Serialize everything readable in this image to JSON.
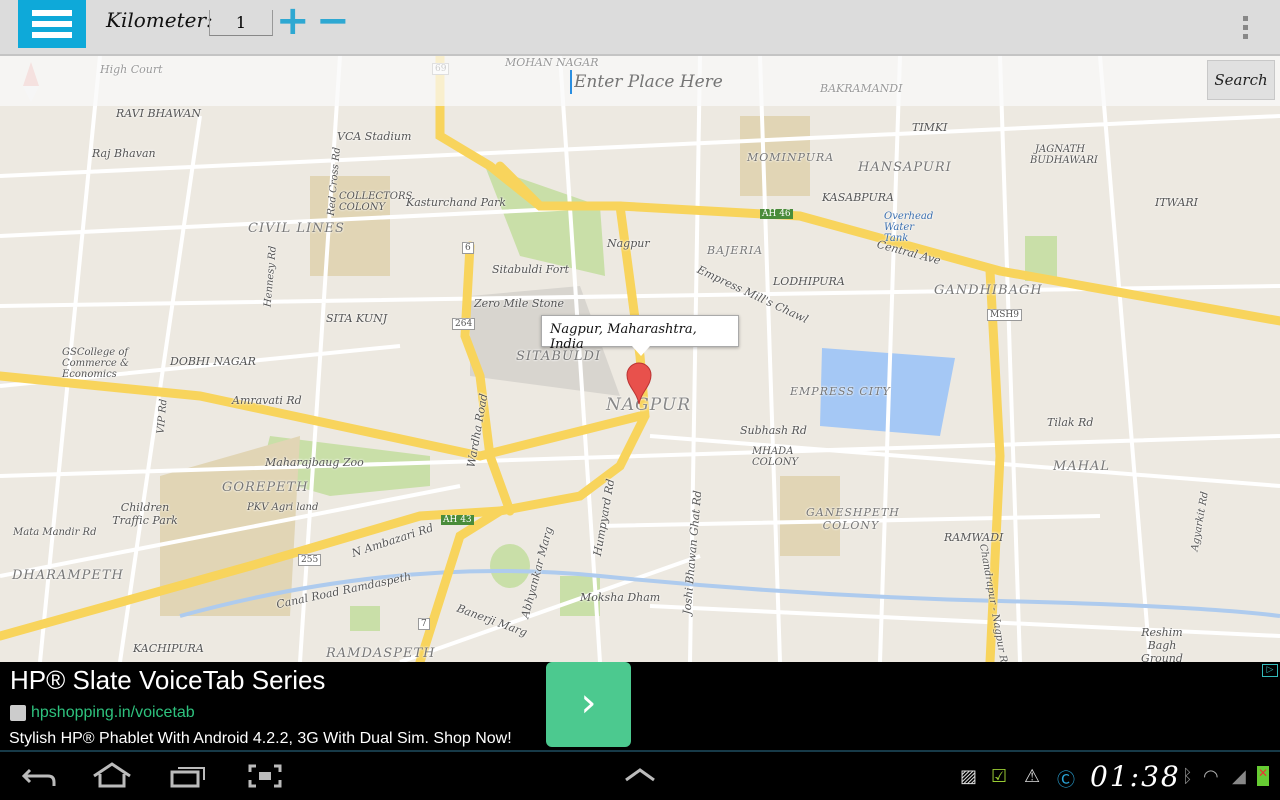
{
  "topbar": {
    "km_label": "Kilometer:",
    "km_value": "1",
    "plus": "+",
    "minus": "−",
    "menu_icon": "hamburger-icon",
    "overflow_icon": "vertical-dots-icon",
    "accent": "#0ea9d9"
  },
  "search": {
    "placeholder": "Enter Place Here",
    "button": "Search"
  },
  "map": {
    "info_window": "Nagpur, Maharashtra, India",
    "labels": [
      "High Court",
      "RAVI BHAWAN",
      "Raj Bhavan",
      "VCA Stadium",
      "COLLECTORS COLONY",
      "Kasturchand Park",
      "CIVIL LINES",
      "Sitabuldi Fort",
      "Zero Mile Stone",
      "SITA KUNJ",
      "SITABULDI",
      "NAGPUR",
      "DOBHI NAGAR",
      "GSCollege of Commerce & Economics",
      "Amravati Rd",
      "Maharajbaug Zoo",
      "GOREPETH",
      "PKV Agri land",
      "Children Traffic Park",
      "Mata Mandir Rd",
      "DHARAMPETH",
      "KACHIPURA",
      "RAMDASPETH",
      "Canal Road Ramdaspeth",
      "N Ambazari Rd",
      "Wardha Road",
      "Humpyard Rd",
      "Moksha Dham",
      "Joshi Bhawan Ghat Rd",
      "Banerji Marg",
      "Abhyankar Marg",
      "Subhash Rd",
      "MHADA COLONY",
      "EMPRESS CITY",
      "GANESHPETH COLONY",
      "MOMINPURA",
      "HANSAPURI",
      "KASABPURA",
      "Overhead Water Tank",
      "Central Ave",
      "BAJERIA",
      "LODHIPURA",
      "Empress Mill's Chawl",
      "GANDHIBAGH",
      "TIMKI",
      "JAGNATH BUDHAWARI",
      "ITWARI",
      "Tilak Rd",
      "MAHAL",
      "RAMWADI",
      "Reshim Bagh Ground",
      "Nagpur",
      "MOHAN NAGAR",
      "BAKRAMANDI",
      "Hennesy Rd",
      "Red Cross Rd",
      "VIP Rd",
      "Chandrapur - Nagpur Rd",
      "Agyarkit Rd"
    ],
    "shields": [
      "69",
      "6",
      "264",
      "255",
      "7",
      "AH 46",
      "AH 43",
      "MSH9"
    ]
  },
  "ad": {
    "title": "HP® Slate VoiceTab Series",
    "url": "hpshopping.in/voicetab",
    "description": "Stylish HP® Phablet With Android 4.2.2, 3G With Dual Sim. Shop Now!",
    "cta_icon": "chevron-right-icon",
    "adchoices": "▷"
  },
  "statusbar": {
    "time": "01:38",
    "icons": [
      "gallery-icon",
      "screen-check-icon",
      "warning-icon",
      "app-c-icon",
      "bluetooth-icon",
      "wifi-icon",
      "signal-icon",
      "battery-icon"
    ]
  },
  "navbar": {
    "icons": [
      "back-icon",
      "home-icon",
      "recent-apps-icon",
      "screenshot-icon",
      "up-chevron-icon"
    ]
  }
}
